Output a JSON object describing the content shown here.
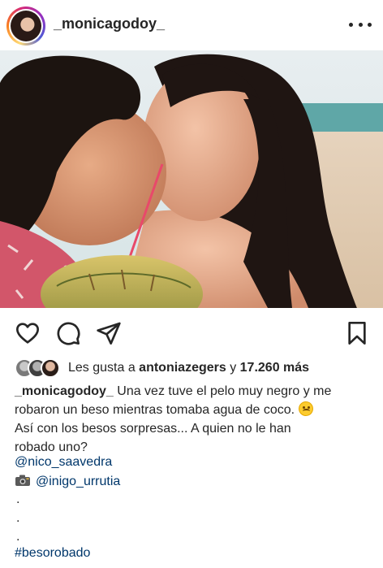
{
  "post": {
    "username": "_monicagodoy_"
  },
  "likes": {
    "prefix": "Les gusta a ",
    "user": "antoniazegers",
    "middle": " y ",
    "count": "17.260 más"
  },
  "caption": {
    "user": "_monicagodoy_",
    "line1": " Una vez tuve el pelo muy negro y me",
    "line2": "robaron un beso mientras tomaba agua de coco.",
    "line3": "Así con los besos sorpresas... A quien no le han",
    "line4": "robado uno?"
  },
  "mentions": {
    "tag1": "@nico_saavedra",
    "tag2": "@inigo_urrutia"
  },
  "dots": [
    ".",
    ".",
    "."
  ],
  "hashtag": "#besorobado",
  "icons": {
    "more": "more-options-icon",
    "like": "heart-icon",
    "comment": "comment-icon",
    "share": "paper-plane-icon",
    "save": "bookmark-icon",
    "camera": "camera-icon",
    "emoji": "upside-down-face-emoji"
  },
  "colors": {
    "text": "#262626",
    "link": "#00376b"
  }
}
